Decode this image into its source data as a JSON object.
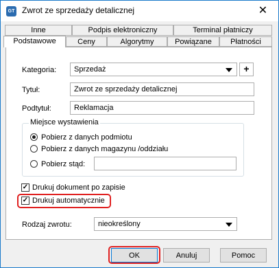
{
  "window": {
    "title": "Zwrot ze sprzedaży detalicznej",
    "icon_text": "GT",
    "close_glyph": "✕"
  },
  "tabs": {
    "row_back": [
      "Inne",
      "Podpis elektroniczny",
      "Terminal płatniczy"
    ],
    "row_front": [
      "Podstawowe",
      "Ceny",
      "Algorytmy",
      "Powiązane",
      "Płatności"
    ],
    "active": "Podstawowe"
  },
  "form": {
    "kategoria_label": "Kategoria:",
    "kategoria_value": "Sprzedaż",
    "plus_glyph": "+",
    "tytul_label": "Tytuł:",
    "tytul_value": "Zwrot ze sprzedaży detalicznej",
    "podtytul_label": "Podtytuł:",
    "podtytul_value": "Reklamacja",
    "group_title": "Miejsce wystawienia",
    "radios": [
      {
        "label": "Pobierz z danych podmiotu",
        "checked": true
      },
      {
        "label": "Pobierz z danych magazynu /oddziału",
        "checked": false
      },
      {
        "label": "Pobierz stąd:",
        "checked": false
      }
    ],
    "stad_value": "",
    "checkboxes": [
      {
        "label": "Drukuj dokument po zapisie",
        "checked": true
      },
      {
        "label": "Drukuj automatycznie",
        "checked": true
      }
    ],
    "rodzaj_label": "Rodzaj zwrotu:",
    "rodzaj_value": "nieokreślony"
  },
  "buttons": {
    "ok": "OK",
    "cancel": "Anuluj",
    "help": "Pomoc"
  },
  "colors": {
    "highlight": "#e02020",
    "accent": "#0078d7",
    "window_border": "#1979ca"
  }
}
